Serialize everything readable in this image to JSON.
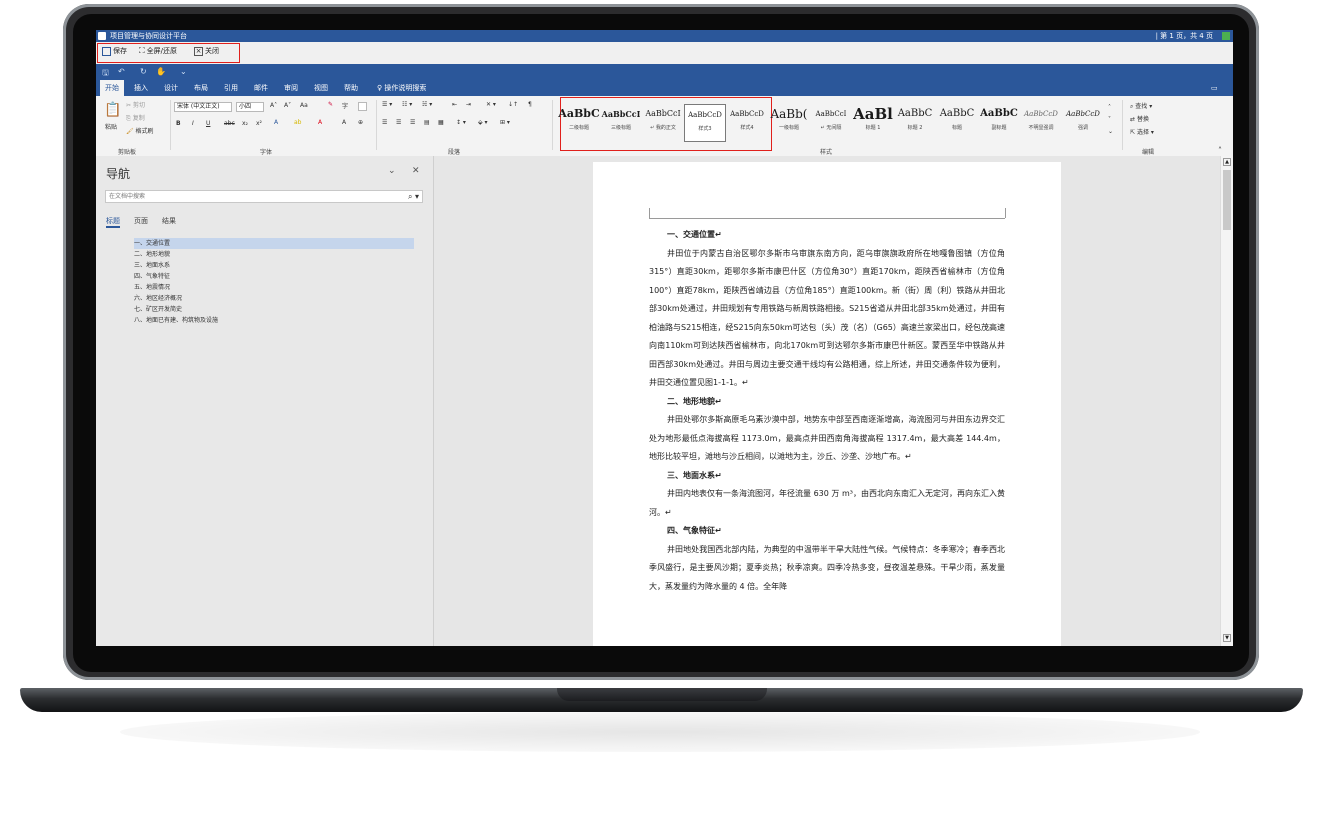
{
  "window": {
    "title": "项目管理与协同设计平台",
    "page_indicator": "| 第 1 页，共 4 页"
  },
  "toolbar": {
    "save": "保存",
    "fullscreen": "全屏/还原",
    "close": "关闭"
  },
  "tabs": [
    "开始",
    "插入",
    "设计",
    "布局",
    "引用",
    "邮件",
    "审阅",
    "视图",
    "帮助",
    "操作说明搜索"
  ],
  "ribbon": {
    "clipboard": {
      "paste": "粘贴",
      "cut": "剪切",
      "copy": "复制",
      "format_painter": "格式刷",
      "label": "剪贴板"
    },
    "font": {
      "name": "宋体 (中文正文)",
      "size": "小四",
      "label": "字体",
      "aa": "Aa"
    },
    "paragraph": {
      "label": "段落"
    },
    "styles": {
      "label": "样式",
      "items": [
        {
          "sample": "AaBbC",
          "name": "二级标题"
        },
        {
          "sample": "AaBbCcI",
          "name": "三级标题"
        },
        {
          "sample": "AaBbCcI",
          "name": "↵ 我的正文"
        },
        {
          "sample": "AaBbCcD",
          "name": "样式3"
        },
        {
          "sample": "AaBbCcD",
          "name": "样式4"
        },
        {
          "sample": "AaBb(",
          "name": "一级标题"
        },
        {
          "sample": "AaBbCcI",
          "name": "↵ 无间隔"
        },
        {
          "sample": "AaBl",
          "name": "标题 1"
        },
        {
          "sample": "AaBbC",
          "name": "标题 2"
        },
        {
          "sample": "AaBbC",
          "name": "标题"
        },
        {
          "sample": "AaBbC",
          "name": "副标题"
        },
        {
          "sample": "AaBbCcD",
          "name": "不明显强调"
        },
        {
          "sample": "AaBbCcD",
          "name": "强调"
        }
      ]
    },
    "editing": {
      "find": "查找",
      "replace": "替换",
      "select": "选择",
      "label": "编辑"
    }
  },
  "nav": {
    "title": "导航",
    "search_placeholder": "在文档中搜索",
    "tabs": [
      "标题",
      "页面",
      "结果"
    ],
    "items": [
      "一、交通位置",
      "二、地形地貌",
      "三、地面水系",
      "四、气象特征",
      "五、地震情况",
      "六、地区经济概况",
      "七、矿区开发简史",
      "八、地面已有建、构筑物及设施"
    ]
  },
  "document": {
    "sections": [
      {
        "heading": "一、交通位置↵",
        "body": "井田位于内蒙古自治区鄂尔多斯市乌审旗东南方向，距乌审旗旗政府所在地嘎鲁图镇（方位角315°）直距30km，距鄂尔多斯市康巴什区（方位角30°）直距170km，距陕西省榆林市（方位角100°）直距78km，距陕西省靖边县（方位角185°）直距100km。新（街）周（利）铁路从井田北部30km处通过，井田规划有专用铁路与新周铁路相接。S215省道从井田北部35km处通过，井田有柏油路与S215相连，经S215向东50km可达包（头）茂（名）（G65）高速兰家梁出口，经包茂高速向南110km可到达陕西省榆林市，向北170km可到达鄂尔多斯市康巴什新区。蒙西至华中铁路从井田西部30km处通过。井田与周边主要交通干线均有公路相通，综上所述，井田交通条件较为便利，井田交通位置见图1-1-1。↵"
      },
      {
        "heading": "二、地形地貌↵",
        "body": "井田处鄂尔多斯高原毛乌素沙漠中部，地势东中部至西南逐渐增高，海流图河与井田东边界交汇处为地形最低点海拔高程 1173.0m，最高点井田西南角海拔高程 1317.4m，最大高差 144.4m，地形比较平坦，滩地与沙丘相间，以滩地为主，沙丘、沙垄、沙地广布。↵"
      },
      {
        "heading": "三、地面水系↵",
        "body": "井田内地表仅有一条海流图河，年径流量 630 万 m³，由西北向东南汇入无定河，再向东汇入黄河。↵"
      },
      {
        "heading": "四、气象特征↵",
        "body": "井田地处我国西北部内陆，为典型的中温带半干旱大陆性气候。气候特点：冬季寒冷；春季西北季风盛行，是主要风沙期；夏季炎热；秋季凉爽。四季冷热多变，昼夜温差悬殊。干旱少雨，蒸发量大，蒸发量约为降水量的 4 倍。全年降"
      }
    ]
  }
}
